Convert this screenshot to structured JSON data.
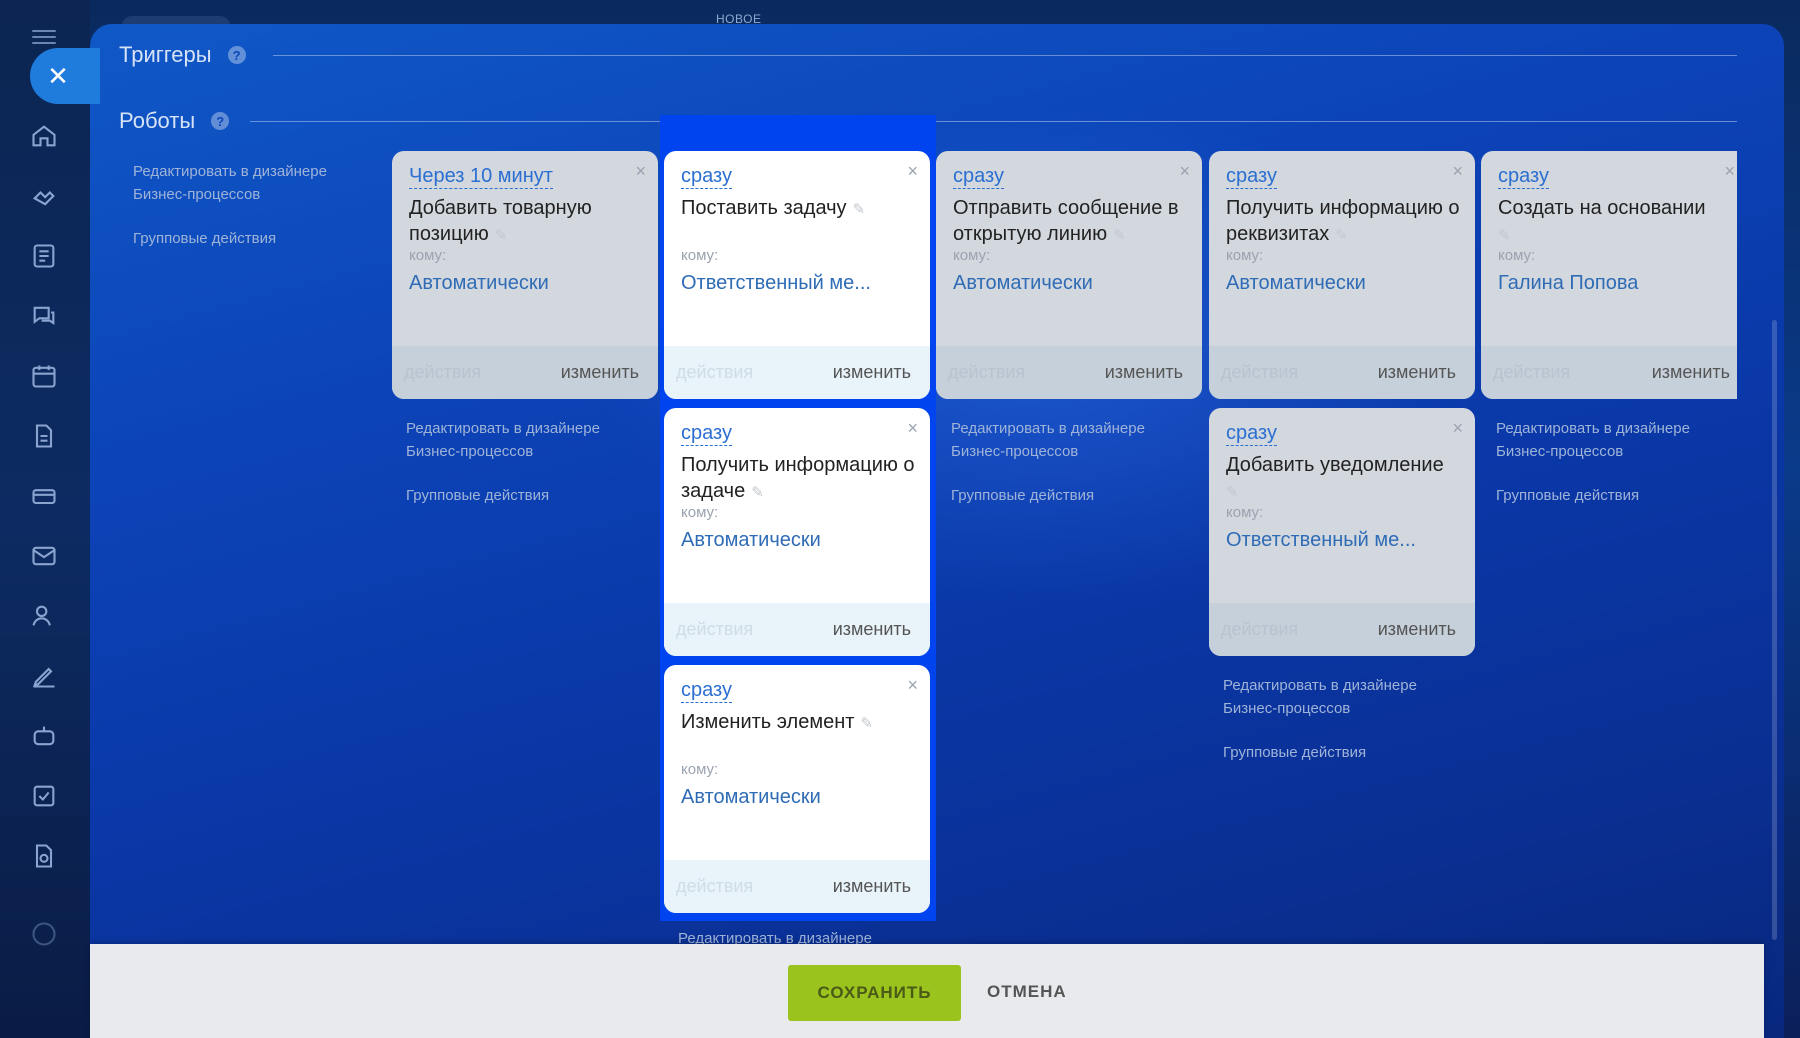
{
  "top": {
    "new_label": "НОВОЕ"
  },
  "panel": {
    "triggers_title": "Триггеры",
    "robots_title": "Роботы",
    "help_glyph": "?",
    "close_glyph": "✕"
  },
  "side_links": {
    "edit_designer": "Редактировать в дизайнере Бизнес-процессов",
    "group_actions": "Групповые действия"
  },
  "robots": [
    {
      "when": "Через 10 минут",
      "title": "Добавить товарную позицию",
      "to_label": "кому:",
      "to_value": "Автоматически",
      "actions": "действия",
      "edit": "изменить"
    },
    {
      "when": "сразу",
      "title": "Поставить задачу",
      "to_label": "кому:",
      "to_value": "Ответственный ме...",
      "actions": "действия",
      "edit": "изменить"
    },
    {
      "when": "сразу",
      "title": "Отправить сообщение в открытую линию",
      "to_label": "кому:",
      "to_value": "Автоматически",
      "actions": "действия",
      "edit": "изменить"
    },
    {
      "when": "сразу",
      "title": "Получить информацию о реквизитах",
      "to_label": "кому:",
      "to_value": "Автоматически",
      "actions": "действия",
      "edit": "изменить"
    },
    {
      "when": "сразу",
      "title": "Создать на основании",
      "to_label": "кому:",
      "to_value": "Галина Попова",
      "actions": "действия",
      "edit": "изменить"
    },
    {
      "when": "сразу",
      "title": "Получить информацию о задаче",
      "to_label": "кому:",
      "to_value": "Автоматически",
      "actions": "действия",
      "edit": "изменить"
    },
    {
      "when": "сразу",
      "title": "Добавить уведомление",
      "to_label": "кому:",
      "to_value": "Ответственный ме...",
      "actions": "действия",
      "edit": "изменить"
    },
    {
      "when": "сразу",
      "title": "Изменить элемент",
      "to_label": "кому:",
      "to_value": "Автоматически",
      "actions": "действия",
      "edit": "изменить"
    }
  ],
  "bottom_peek": "Редактировать в дизайнере",
  "footer": {
    "save": "СОХРАНИТЬ",
    "cancel": "ОТМЕНА"
  }
}
